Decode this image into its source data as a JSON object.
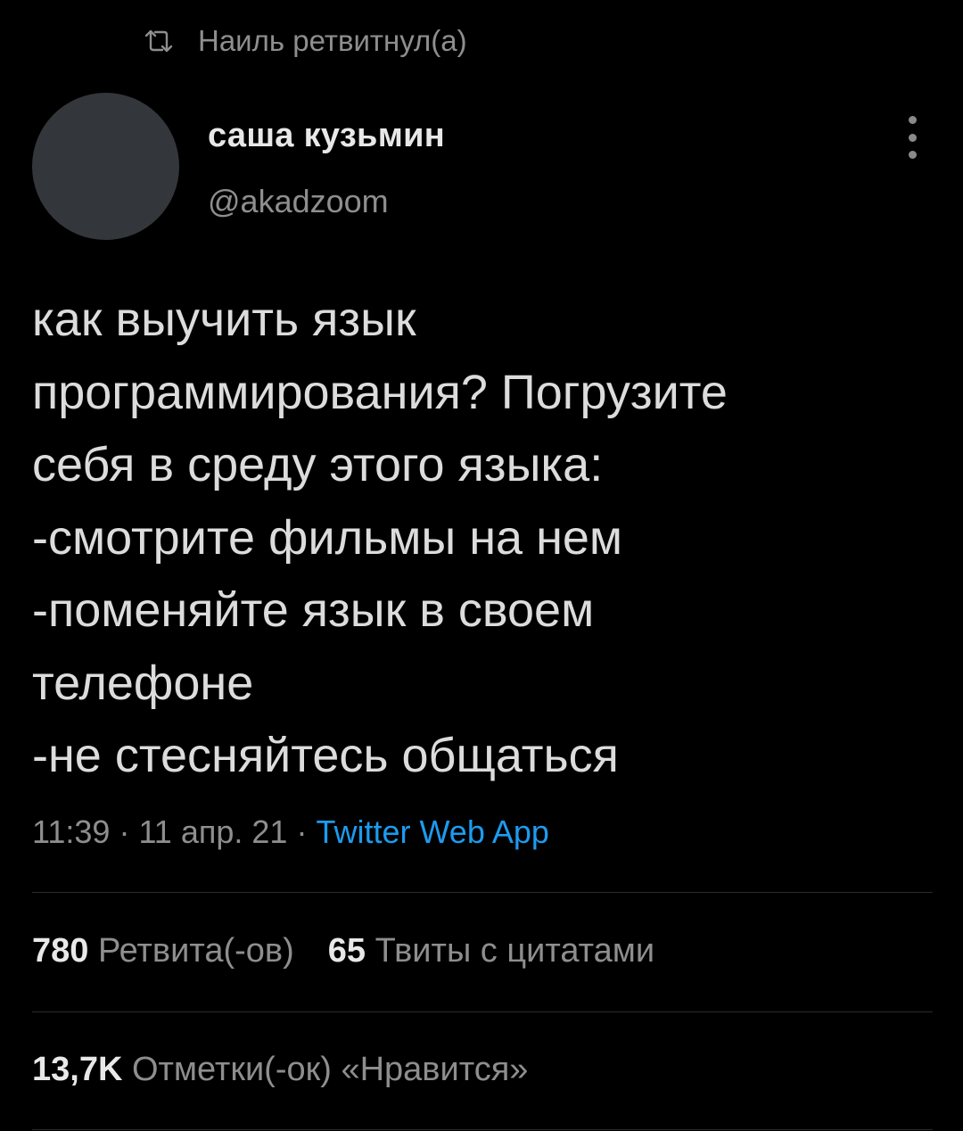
{
  "retweet_banner": {
    "icon": "retweet-icon",
    "text": "Наиль ретвитнул(а)"
  },
  "author": {
    "display_name": "саша кузьмин",
    "handle": "@akadzoom"
  },
  "tweet": {
    "lines": [
      "как выучить язык",
      "программирования? Погрузите",
      "себя в среду этого языка:",
      "-смотрите фильмы на нем",
      "-поменяйте язык в своем",
      "телефоне",
      "-не стесняйтесь общаться"
    ],
    "time": "11:39",
    "date": "11 апр. 21",
    "separator": "·",
    "source": "Twitter Web App"
  },
  "stats": {
    "retweets_count": "780",
    "retweets_label": "Ретвита(-ов)",
    "quotes_count": "65",
    "quotes_label": "Твиты с цитатами",
    "likes_count": "13,7K",
    "likes_label": "Отметки(-ок) «Нравится»"
  },
  "colors": {
    "background": "#000000",
    "text_primary": "#e8e8e8",
    "text_secondary": "#8e8e8e",
    "link": "#1d9bf0",
    "avatar_placeholder": "#33363b",
    "divider": "#2a2a2a"
  }
}
